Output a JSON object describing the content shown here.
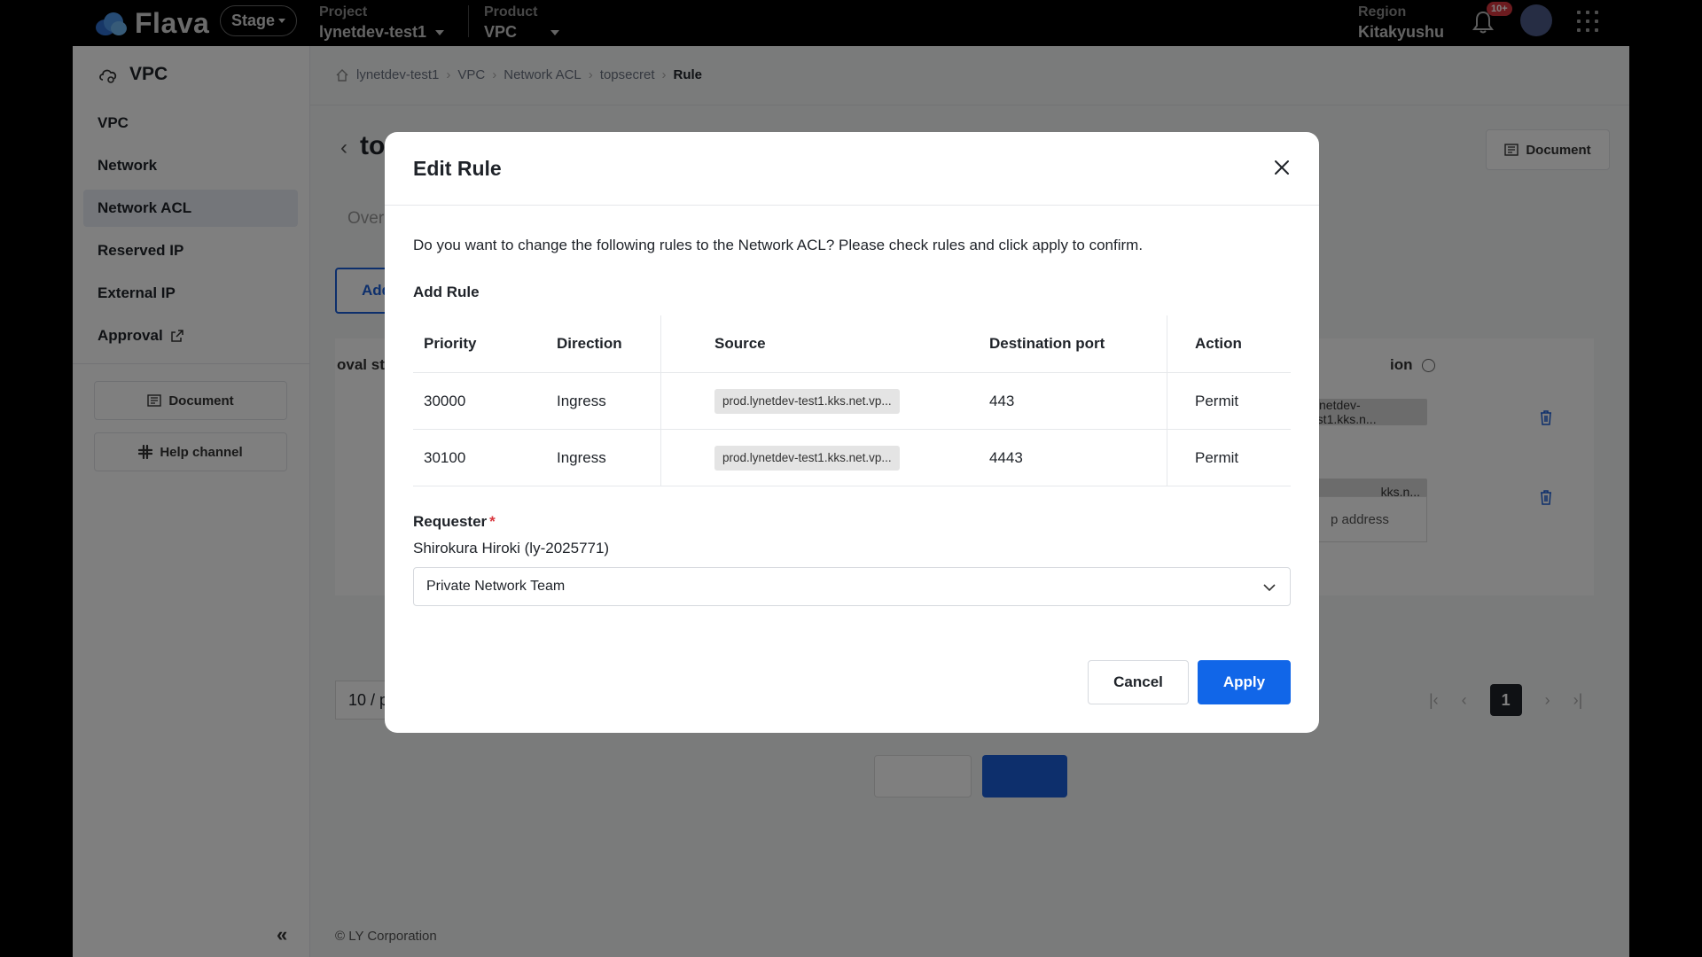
{
  "topbar": {
    "brand": "Flava",
    "stage": "Stage",
    "project_label": "Project",
    "project_value": "lynetdev-test1",
    "product_label": "Product",
    "product_value": "VPC",
    "region_label": "Region",
    "region_value": "Kitakyushu",
    "notification_badge": "10+"
  },
  "sidebar": {
    "title": "VPC",
    "items": [
      {
        "label": "VPC"
      },
      {
        "label": "Network"
      },
      {
        "label": "Network ACL"
      },
      {
        "label": "Reserved IP"
      },
      {
        "label": "External IP"
      },
      {
        "label": "Approval"
      }
    ],
    "document_label": "Document",
    "help_label": "Help channel"
  },
  "breadcrumb": [
    "lynetdev-test1",
    "VPC",
    "Network ACL",
    "topsecret",
    "Rule"
  ],
  "background": {
    "title_fragment": "to",
    "document_label": "Document",
    "tab_fragment": "Over",
    "add_fragment": "Add",
    "col_fragment_left": "oval st",
    "col_fragment_right": "ion",
    "chip_1": ".lynetdev-test1.kks.n...",
    "chip_2": "kks.n...",
    "tooltip_fragment": "p address",
    "pagesize_fragment": "10 / p",
    "current_page": "1",
    "copyright": "© LY Corporation"
  },
  "modal": {
    "title": "Edit Rule",
    "description": "Do you want to change the following rules to the Network ACL? Please check rules and click apply to confirm.",
    "section_title": "Add Rule",
    "columns": [
      "Priority",
      "Direction",
      "Source",
      "Destination port",
      "Action"
    ],
    "rows": [
      {
        "priority": "30000",
        "direction": "Ingress",
        "source": "prod.lynetdev-test1.kks.net.vp...",
        "port": "443",
        "action": "Permit"
      },
      {
        "priority": "30100",
        "direction": "Ingress",
        "source": "prod.lynetdev-test1.kks.net.vp...",
        "port": "4443",
        "action": "Permit"
      }
    ],
    "requester_label": "Requester",
    "required_mark": "*",
    "requester_name": "Shirokura Hiroki (ly-2025771)",
    "team_select": "Private Network Team",
    "cancel_label": "Cancel",
    "apply_label": "Apply"
  },
  "colors": {
    "primary": "#1166e8",
    "required": "#d9363e",
    "overlay": "rgba(0,0,0,0.5)"
  }
}
